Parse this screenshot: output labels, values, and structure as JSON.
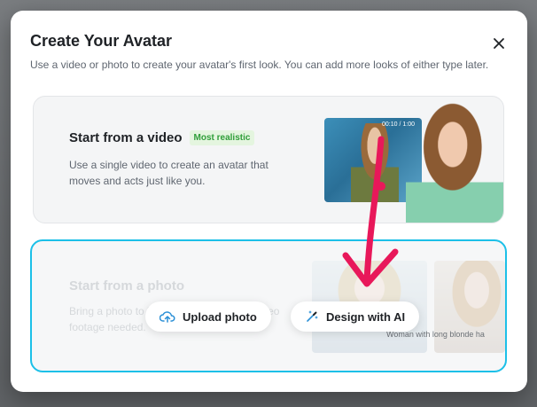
{
  "modal": {
    "title": "Create Your Avatar",
    "subtitle": "Use a video or photo to create your avatar's first look. You can add more looks of either type later.",
    "close_icon": "close-icon"
  },
  "video_card": {
    "title": "Start from a video",
    "badge": "Most realistic",
    "description": "Use a single video to create an avatar that moves and acts just like you.",
    "thumb_timestamp": "00:10 / 1:00"
  },
  "photo_card": {
    "title": "Start from a photo",
    "description": "Bring a photo to life with AI motion - no video footage needed.",
    "upload_label": "Upload photo",
    "upload_icon": "cloud-upload-icon",
    "design_label": "Design with AI",
    "design_icon": "magic-wand-icon",
    "sample_caption": "Woman with long blonde ha"
  },
  "colors": {
    "accent_border": "#1cc0e8",
    "badge_green": "#2f9e39",
    "arrow_pink": "#e8185a"
  }
}
